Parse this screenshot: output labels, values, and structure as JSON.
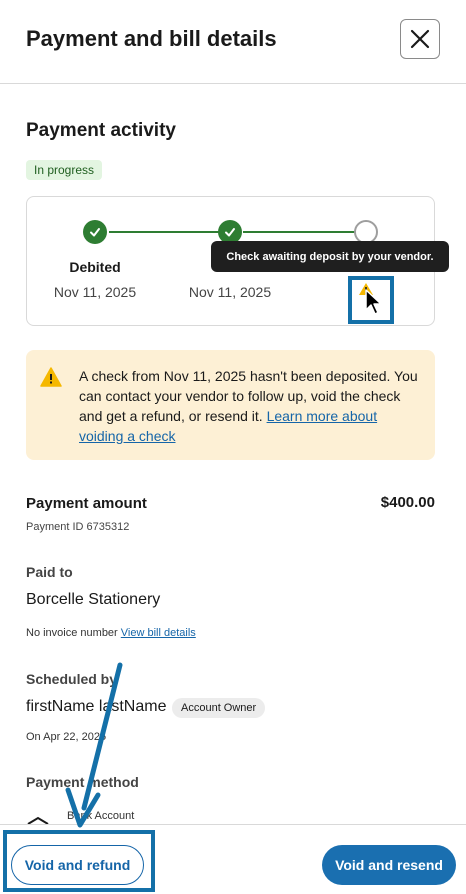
{
  "header": {
    "title": "Payment and bill details",
    "close_icon": "close-icon"
  },
  "activity": {
    "title": "Payment activity",
    "status_badge": "In progress",
    "steps": [
      {
        "label": "Debited",
        "date": "Nov 11, 2025",
        "state": "done"
      },
      {
        "label": "",
        "date": "Nov 11, 2025",
        "state": "done"
      },
      {
        "label": "",
        "date": "",
        "state": "pending"
      }
    ],
    "tooltip": "Check awaiting deposit by your vendor."
  },
  "alert": {
    "text": "A check from Nov 11, 2025 hasn't been deposited. You can contact your vendor to follow up, void the check and get a refund, or resend it. ",
    "link": "Learn more about voiding a check"
  },
  "payment": {
    "amount_label": "Payment amount",
    "amount_value": "$400.00",
    "payment_id": "Payment ID 6735312"
  },
  "paid_to": {
    "label": "Paid to",
    "value": "Borcelle Stationery",
    "invoice_text": "No invoice number ",
    "invoice_link": "View bill details"
  },
  "scheduled": {
    "label": "Scheduled by",
    "name": "firstName lastName",
    "role_badge": "Account Owner",
    "date": "On Apr 22, 2025"
  },
  "method": {
    "label": "Payment method",
    "account": "Bank Account"
  },
  "footer": {
    "void_refund": "Void and refund",
    "void_resend": "Void and resend"
  },
  "colors": {
    "accent": "#1565a8",
    "success": "#2e7d32",
    "warning_bg": "#fdf0d5",
    "warning_icon": "#f5b800",
    "annotation": "#1470a8"
  }
}
